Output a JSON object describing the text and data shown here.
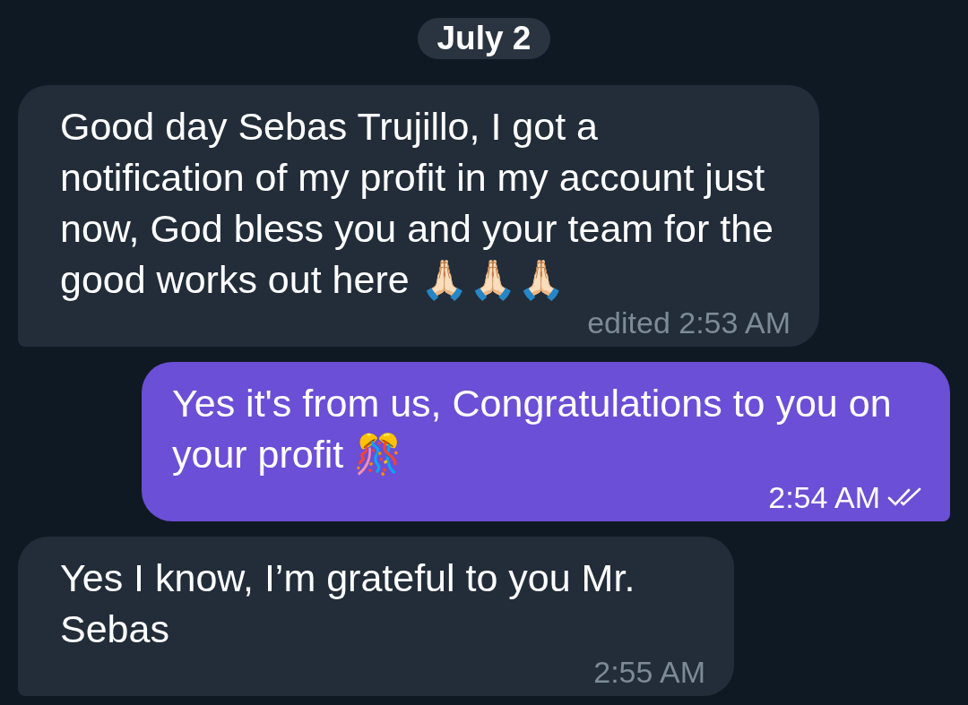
{
  "date_badge": "July 2",
  "messages": [
    {
      "kind": "incoming",
      "text": "Good day Sebas Trujillo, I got a notification of my profit in my account just now, God bless you and your team for the good works out here 🙏🏻🙏🏻🙏🏻",
      "time": "edited 2:53 AM"
    },
    {
      "kind": "outgoing",
      "text": "Yes it's from us, Congratulations to you on your profit 🎊",
      "time": "2:54 AM",
      "read": true
    },
    {
      "kind": "incoming",
      "text": "Yes I know, I’m grateful to you Mr. Sebas",
      "time": "2:55 AM"
    }
  ]
}
